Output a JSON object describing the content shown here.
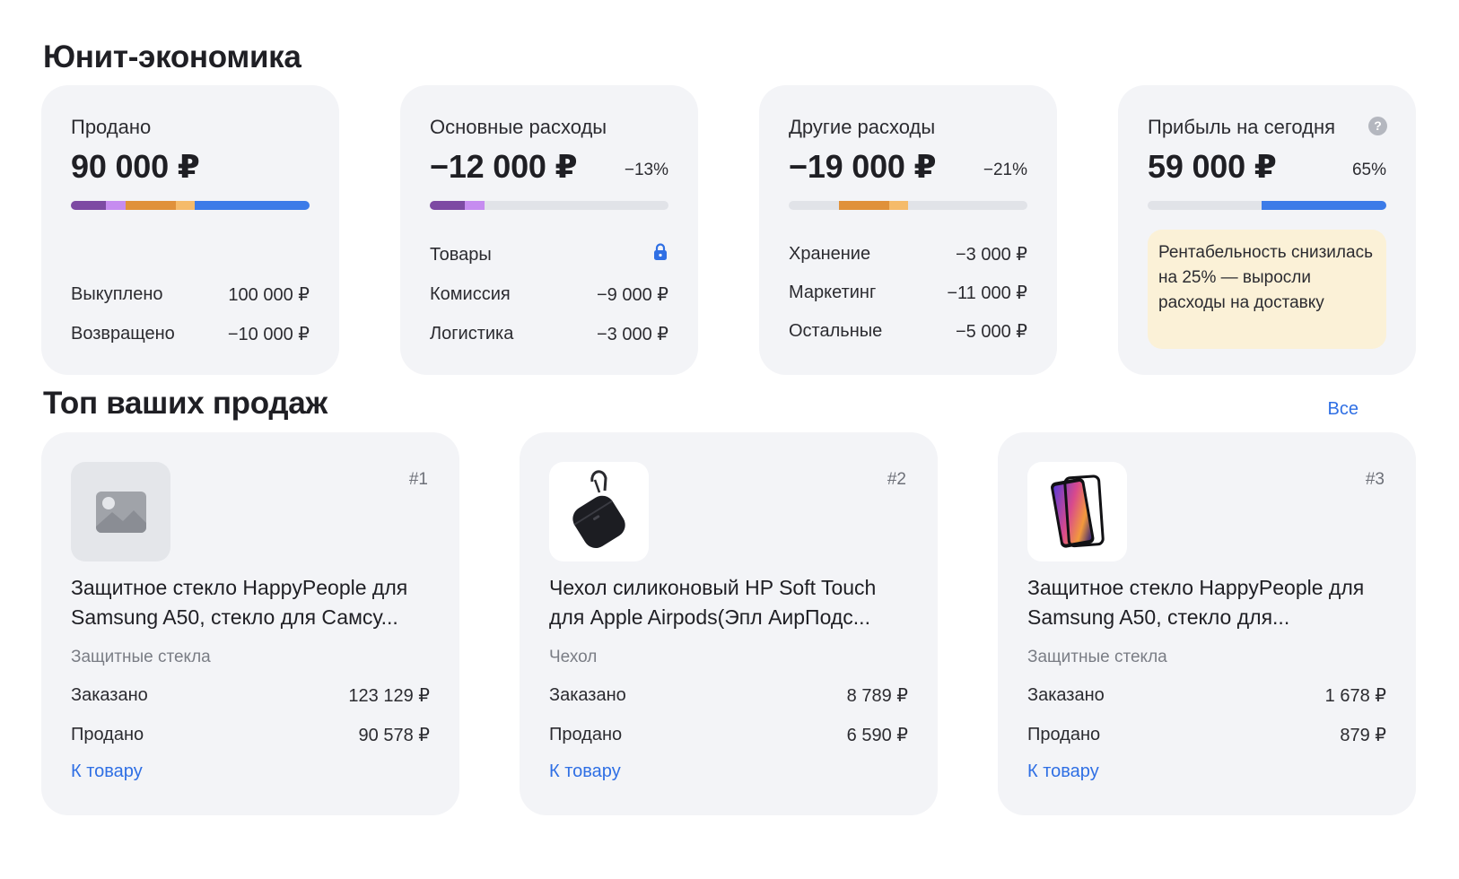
{
  "unit_economics": {
    "title": "Юнит-экономика",
    "cards": [
      {
        "label": "Продано",
        "value": "90 000 ₽",
        "rows": [
          {
            "label": "Выкуплено",
            "value": "100 000 ₽"
          },
          {
            "label": "Возвращено",
            "value": "−10 000 ₽"
          }
        ]
      },
      {
        "label": "Основные расходы",
        "value": "−12 000 ₽",
        "percent": "−13%",
        "rows": [
          {
            "label": "Товары",
            "icon": "lock-icon"
          },
          {
            "label": "Комиссия",
            "value": "−9 000 ₽"
          },
          {
            "label": "Логистика",
            "value": "−3 000 ₽"
          }
        ]
      },
      {
        "label": "Другие расходы",
        "value": "−19 000 ₽",
        "percent": "−21%",
        "rows": [
          {
            "label": "Хранение",
            "value": "−3 000 ₽"
          },
          {
            "label": "Маркетинг",
            "value": "−11 000 ₽"
          },
          {
            "label": "Остальные",
            "value": "−5 000 ₽"
          }
        ]
      },
      {
        "label": "Прибыль на сегодня",
        "value": "59 000 ₽",
        "percent": "65%",
        "help_icon": "question-circle-icon",
        "help_glyph": "?",
        "note": "Рентабельность снизилась на 25% — выросли расходы на доставку"
      }
    ]
  },
  "top_sales": {
    "title": "Топ ваших продаж",
    "all_link": "Все",
    "items": [
      {
        "rank": "#1",
        "image": "image-placeholder-icon",
        "name": "Защитное стекло HappyPeople для Samsung A50, стекло для Самсу...",
        "category": "Защитные стекла",
        "ordered_label": "Заказано",
        "ordered": "123 129 ₽",
        "sold_label": "Продано",
        "sold": "90 578 ₽",
        "link": "К товару"
      },
      {
        "rank": "#2",
        "image": "airpods-case-image",
        "name": "Чехол силиконовый HP Soft Touch для Apple Airpods(Эпл АирПодс...",
        "category": "Чехол",
        "ordered_label": "Заказано",
        "ordered": "8 789 ₽",
        "sold_label": "Продано",
        "sold": "6 590 ₽",
        "link": "К товару"
      },
      {
        "rank": "#3",
        "image": "smartphone-glass-image",
        "name": "Защитное стекло HappyPeople для Samsung A50, стекло для...",
        "category": "Защитные стекла",
        "ordered_label": "Заказано",
        "ordered": "1 678 ₽",
        "sold_label": "Продано",
        "sold": "879 ₽",
        "link": "К товару"
      }
    ]
  },
  "colors": {
    "purple": "#7d4aa3",
    "lilac": "#c68cf0",
    "orange": "#e0913a",
    "light_orange": "#f5bb6a",
    "blue": "#3c7be8",
    "link": "#2f6fe4",
    "card_bg": "#f3f4f7",
    "note_bg": "#fbf1d7"
  }
}
